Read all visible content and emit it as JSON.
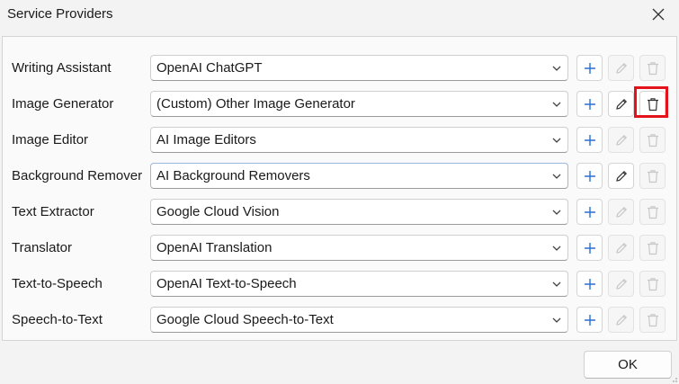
{
  "window": {
    "title": "Service Providers"
  },
  "rows": [
    {
      "label": "Writing Assistant",
      "value": "OpenAI ChatGPT",
      "edit_enabled": false,
      "delete_enabled": false
    },
    {
      "label": "Image Generator",
      "value": "(Custom) Other Image Generator",
      "edit_enabled": true,
      "delete_enabled": true
    },
    {
      "label": "Image Editor",
      "value": "AI Image Editors",
      "edit_enabled": false,
      "delete_enabled": false
    },
    {
      "label": "Background Remover",
      "value": "AI Background Removers",
      "edit_enabled": true,
      "delete_enabled": false
    },
    {
      "label": "Text Extractor",
      "value": "Google Cloud Vision",
      "edit_enabled": false,
      "delete_enabled": false
    },
    {
      "label": "Translator",
      "value": "OpenAI Translation",
      "edit_enabled": false,
      "delete_enabled": false
    },
    {
      "label": "Text-to-Speech",
      "value": "OpenAI Text-to-Speech",
      "edit_enabled": false,
      "delete_enabled": false
    },
    {
      "label": "Speech-to-Text",
      "value": "Google Cloud Speech-to-Text",
      "edit_enabled": false,
      "delete_enabled": false
    }
  ],
  "footer": {
    "ok_label": "OK"
  },
  "colors": {
    "accent": "#2a6fd6",
    "highlight": "#e3121b",
    "disabled_icon": "#c8c8c8"
  }
}
